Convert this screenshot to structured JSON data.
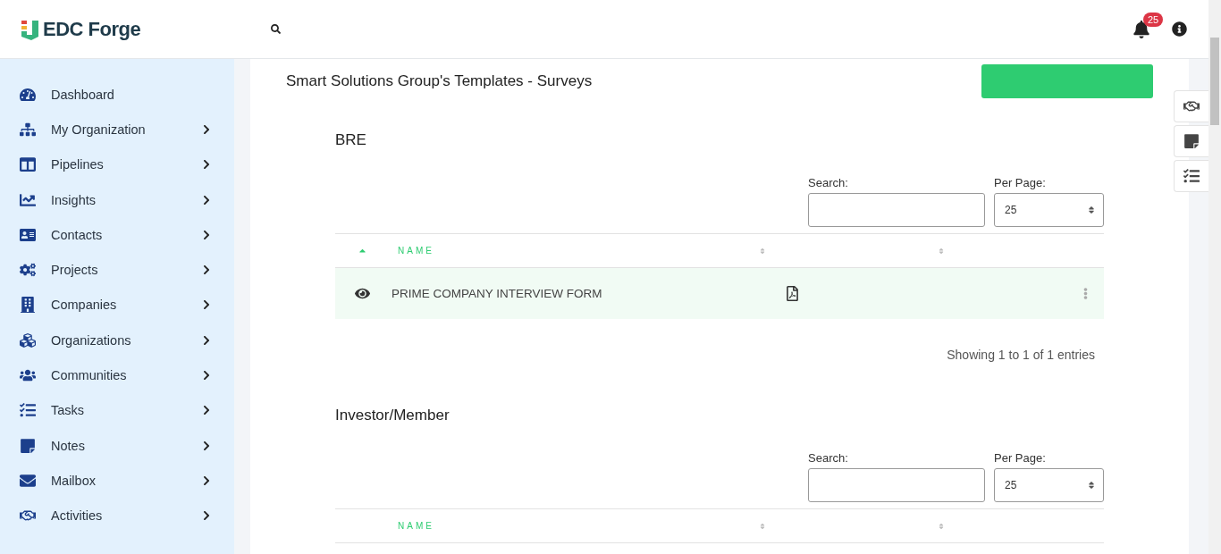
{
  "header": {
    "logo": "EDC Forge",
    "notification_count": "25"
  },
  "page": {
    "title": "Smart Solutions Group's Templates - Surveys"
  },
  "sidebar": {
    "items": [
      {
        "label": "Dashboard",
        "has_submenu": false
      },
      {
        "label": "My Organization",
        "has_submenu": true
      },
      {
        "label": "Pipelines",
        "has_submenu": true
      },
      {
        "label": "Insights",
        "has_submenu": true
      },
      {
        "label": "Contacts",
        "has_submenu": true
      },
      {
        "label": "Projects",
        "has_submenu": true
      },
      {
        "label": "Companies",
        "has_submenu": true
      },
      {
        "label": "Organizations",
        "has_submenu": true
      },
      {
        "label": "Communities",
        "has_submenu": true
      },
      {
        "label": "Tasks",
        "has_submenu": true
      },
      {
        "label": "Notes",
        "has_submenu": true
      },
      {
        "label": "Mailbox",
        "has_submenu": true
      },
      {
        "label": "Activities",
        "has_submenu": true
      }
    ]
  },
  "sections": [
    {
      "title": "BRE",
      "search_label": "Search:",
      "per_page_label": "Per Page:",
      "per_page_value": "25",
      "sorted": true,
      "column_label": "NAME",
      "rows": [
        {
          "name": "PRIME COMPANY INTERVIEW FORM"
        }
      ],
      "footer": "Showing 1 to 1 of 1 entries"
    },
    {
      "title": "Investor/Member",
      "search_label": "Search:",
      "per_page_label": "Per Page:",
      "per_page_value": "25",
      "column_label": "NAME"
    }
  ]
}
